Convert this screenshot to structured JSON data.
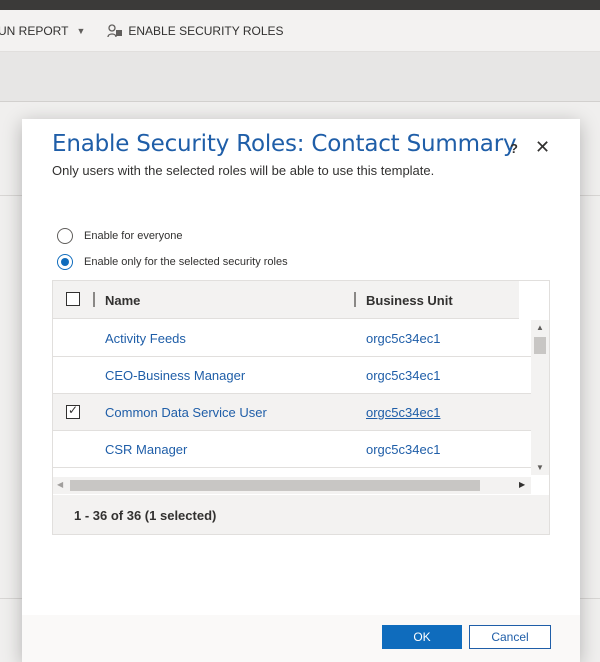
{
  "commandbar": {
    "report_label": "UN REPORT",
    "security_label": "ENABLE SECURITY ROLES"
  },
  "dialog": {
    "title": "Enable Security Roles: Contact Summary",
    "help_glyph": "?",
    "close_glyph": "✕",
    "subtitle": "Only users with the selected roles will be able to use this template.",
    "radio_everyone": "Enable for everyone",
    "radio_selected": "Enable only for the selected security roles",
    "selected_option": "selected"
  },
  "grid": {
    "columns": [
      "Name",
      "Business Unit"
    ],
    "rows": [
      {
        "name": "Activity Feeds",
        "business_unit": "orgc5c34ec1",
        "checked": false
      },
      {
        "name": "CEO-Business Manager",
        "business_unit": "orgc5c34ec1",
        "checked": false
      },
      {
        "name": "Common Data Service User",
        "business_unit": "orgc5c34ec1",
        "checked": true
      },
      {
        "name": "CSR Manager",
        "business_unit": "orgc5c34ec1",
        "checked": false
      }
    ],
    "footer": "1 - 36 of 36 (1 selected)"
  },
  "buttons": {
    "ok": "OK",
    "cancel": "Cancel"
  },
  "colors": {
    "accent": "#0f6cbd",
    "link": "#1f5ea8"
  }
}
